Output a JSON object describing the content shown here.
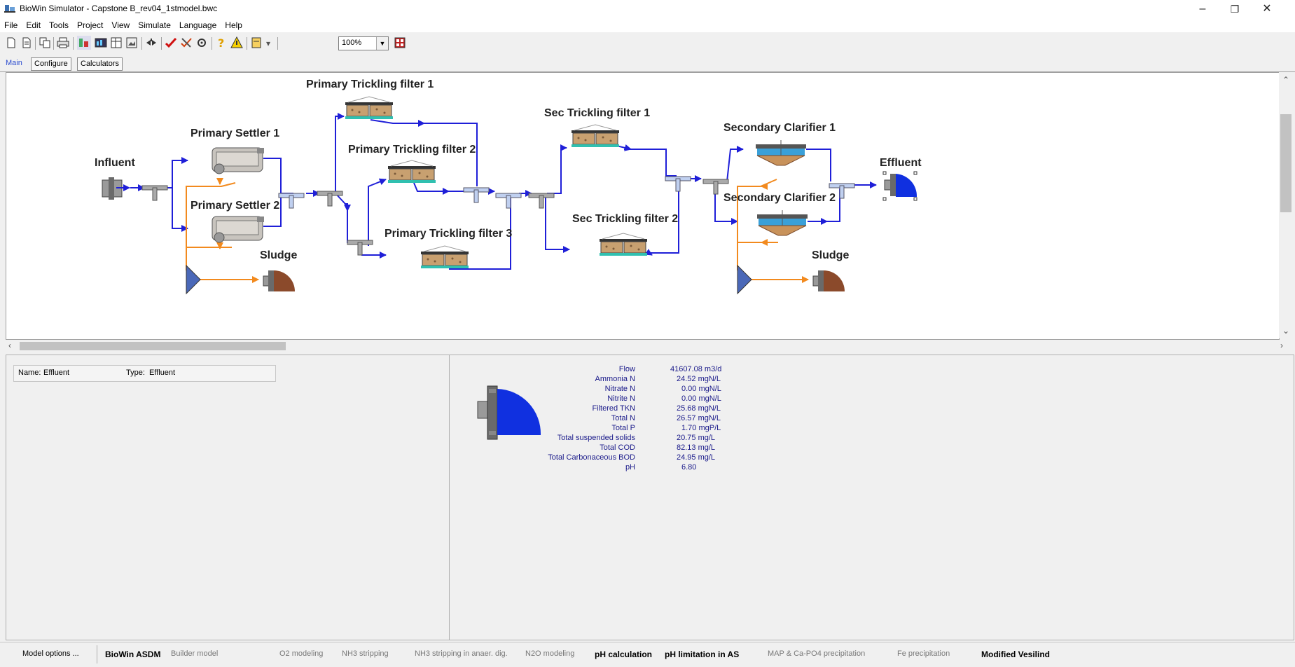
{
  "window": {
    "title": "BioWin Simulator - Capstone B_rev04_1stmodel.bwc",
    "minimize": "–",
    "maximize": "❐",
    "close": "✕"
  },
  "menu": [
    "File",
    "Edit",
    "Tools",
    "Project",
    "View",
    "Simulate",
    "Language",
    "Help"
  ],
  "toolbar": {
    "zoom": "100%"
  },
  "tabs": [
    "Main",
    "Configure",
    "Calculators"
  ],
  "diagram": {
    "labels": {
      "influent": "Influent",
      "primary_settler_1": "Primary Settler 1",
      "primary_settler_2": "Primary Settler 2",
      "sludge_1": "Sludge",
      "ptf1": "Primary Trickling filter 1",
      "ptf2": "Primary Trickling filter 2",
      "ptf3": "Primary Trickling filter 3",
      "stf1": "Sec Trickling filter 1",
      "stf2": "Sec Trickling filter 2",
      "sc1": "Secondary Clarifier 1",
      "sc2": "Secondary Clarifier 2",
      "effluent": "Effluent",
      "sludge_2": "Sludge"
    },
    "colors": {
      "flow": "#1f1fd8",
      "recycle": "#f28a1e",
      "effluent_fill": "#1030e0",
      "sludge_fill": "#8b4a2b"
    }
  },
  "info": {
    "name_label": "Name:",
    "name_value": "Effluent",
    "type_label": "Type:",
    "type_value": "Effluent"
  },
  "results": [
    {
      "label": "Flow",
      "value": "41607.08 m3/d"
    },
    {
      "label": "Ammonia N",
      "value": "24.52 mgN/L"
    },
    {
      "label": "Nitrate N",
      "value": "0.00 mgN/L"
    },
    {
      "label": "Nitrite N",
      "value": "0.00 mgN/L"
    },
    {
      "label": "Filtered TKN",
      "value": "25.68 mgN/L"
    },
    {
      "label": "Total N",
      "value": "26.57 mgN/L"
    },
    {
      "label": "Total P",
      "value": "1.70 mgP/L"
    },
    {
      "label": "Total suspended solids",
      "value": "20.75 mg/L"
    },
    {
      "label": "Total COD",
      "value": "82.13 mg/L"
    },
    {
      "label": "Total Carbonaceous BOD",
      "value": "24.95 mg/L"
    },
    {
      "label": "pH",
      "value": "6.80"
    }
  ],
  "statusbar": {
    "model_options": "Model options ...",
    "items": [
      {
        "text": "BioWin ASDM",
        "bold": true
      },
      {
        "text": "Builder model",
        "bold": false
      },
      {
        "text": "O2 modeling",
        "bold": false
      },
      {
        "text": "NH3 stripping",
        "bold": false
      },
      {
        "text": "NH3 stripping in anaer. dig.",
        "bold": false
      },
      {
        "text": "N2O modeling",
        "bold": false
      },
      {
        "text": "pH calculation",
        "bold": true
      },
      {
        "text": "pH limitation in AS",
        "bold": true
      },
      {
        "text": "MAP & Ca-PO4 precipitation",
        "bold": false
      },
      {
        "text": "Fe precipitation",
        "bold": false
      },
      {
        "text": "Modified Vesilind",
        "bold": true
      }
    ]
  }
}
